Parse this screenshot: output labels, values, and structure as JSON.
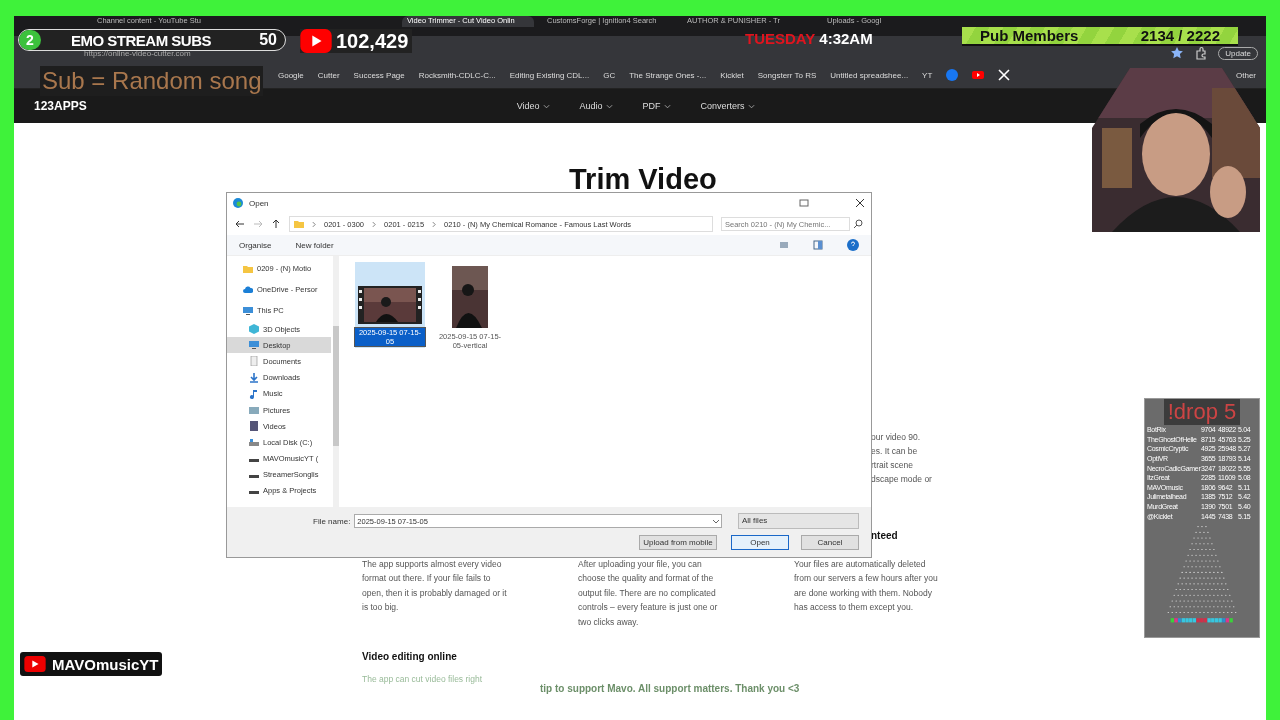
{
  "browser": {
    "tabs": [
      {
        "label": "Channel content - YouTube Stu",
        "selected": false
      },
      {
        "label": "Video Trimmer - Cut Video Onlin",
        "selected": true
      },
      {
        "label": "CustomsForge | Ignition4 Search",
        "selected": false
      },
      {
        "label": "AUTHOR & PUNISHER - Tr",
        "selected": false
      },
      {
        "label": "Uploads - Googl",
        "selected": false
      }
    ],
    "address": "https://online-video-cutter.com",
    "update_button": "Update",
    "bookmarks": [
      {
        "label": "Google"
      },
      {
        "label": "Cutter"
      },
      {
        "label": "Success Page"
      },
      {
        "label": "Rocksmith-CDLC-C..."
      },
      {
        "label": "Editing Existing CDL..."
      },
      {
        "label": "GC"
      },
      {
        "label": "The Strange Ones -..."
      },
      {
        "label": "Kicklet"
      },
      {
        "label": "Songsterr To RS"
      },
      {
        "label": "Untitled spreadshee..."
      },
      {
        "label": "YT"
      }
    ],
    "other_bookmarks": "Other"
  },
  "site": {
    "logo": "123APPS",
    "nav": [
      "Video",
      "Audio",
      "PDF",
      "Converters"
    ],
    "heading": "Trim Video",
    "partial_lines": [
      "our video 90.",
      "es. It can be",
      "rtrait scene",
      "dscape mode or"
    ],
    "partial_heading": "nteed",
    "features": [
      "The app supports almost every video format out there. If your file fails to open, then it is probably damaged or it is too big.",
      "After uploading your file, you can choose the quality and format of the output file. There are no complicated controls – every feature is just one or two clicks away.",
      "Your files are automatically deleted from our servers a few hours after you are done working with them. Nobody has access to them except you."
    ],
    "section_heading": "Video editing online",
    "section_text": "The app can cut video files right"
  },
  "dialog": {
    "title": "Open",
    "path": [
      "0201 - 0300",
      "0201 - 0215",
      "0210 - (N) My Chemical Romance - Famous Last Words"
    ],
    "search_placeholder": "Search 0210 - (N) My Chemic...",
    "toolbar": [
      "Organise",
      "New folder"
    ],
    "tree": [
      {
        "label": "0209 - (N) Motio",
        "kind": "folder",
        "selected": false
      },
      {
        "label": "OneDrive - Persor",
        "kind": "cloud",
        "selected": false
      },
      {
        "label": "This PC",
        "kind": "pc",
        "selected": false
      },
      {
        "label": "3D Objects",
        "kind": "cube",
        "selected": false
      },
      {
        "label": "Desktop",
        "kind": "desktop",
        "selected": true
      },
      {
        "label": "Documents",
        "kind": "doc",
        "selected": false
      },
      {
        "label": "Downloads",
        "kind": "download",
        "selected": false
      },
      {
        "label": "Music",
        "kind": "music",
        "selected": false
      },
      {
        "label": "Pictures",
        "kind": "pictures",
        "selected": false
      },
      {
        "label": "Videos",
        "kind": "videos",
        "selected": false
      },
      {
        "label": "Local Disk (C:)",
        "kind": "disk",
        "selected": false
      },
      {
        "label": "MAVOmusicYT (",
        "kind": "drive",
        "selected": false
      },
      {
        "label": "StreamerSonglis",
        "kind": "drive",
        "selected": false
      },
      {
        "label": "Apps & Projects",
        "kind": "drive",
        "selected": false
      }
    ],
    "files": [
      {
        "name": "2025-09-15 07-15-05",
        "kind": "landscape",
        "selected": true
      },
      {
        "name": "2025-09-15 07-15-05-vertical",
        "kind": "portrait",
        "selected": false
      }
    ],
    "file_name_label": "File name:",
    "file_name": "2025-09-15 07-15-05",
    "file_type": "All files",
    "buttons": [
      "Upload from mobile",
      "Open",
      "Cancel"
    ]
  },
  "overlay": {
    "sub_goal": {
      "count": "2",
      "label": "EMO STREAM SUBS",
      "target": "50"
    },
    "youtube_subs": "102,429",
    "sub_note": "Sub = Random song",
    "day": "TUESDAY",
    "time": "4:32AM",
    "members": {
      "label": "Pub Members",
      "value": "2134 / 2222"
    },
    "channel_badge": "MAVOmusicYT",
    "ticker": "tip to support Mavo. All support matters. Thank you <3",
    "drop": {
      "title": "!drop 5",
      "rows": [
        {
          "name": "BotRix",
          "col_2": "9704",
          "col_3": "48922",
          "col_4": "5.04"
        },
        {
          "name": "TheGhostOfHelle",
          "col_2": "8715",
          "col_3": "45763",
          "col_4": "5.25"
        },
        {
          "name": "CosmicCryptic",
          "col_2": "4925",
          "col_3": "25948",
          "col_4": "5.27"
        },
        {
          "name": "OptiVR",
          "col_2": "3655",
          "col_3": "18793",
          "col_4": "5.14"
        },
        {
          "name": "NecroCadicGamer",
          "col_2": "3247",
          "col_3": "18022",
          "col_4": "5.55"
        },
        {
          "name": "ItzGreat",
          "col_2": "2285",
          "col_3": "11609",
          "col_4": "5.08"
        },
        {
          "name": "MAVOmusic",
          "col_2": "1806",
          "col_3": "9642",
          "col_4": "5.11"
        },
        {
          "name": "Julimetalhead",
          "col_2": "1385",
          "col_3": "7512",
          "col_4": "5.42"
        },
        {
          "name": "MurdGreat",
          "col_2": "1390",
          "col_3": "7501",
          "col_4": "5.40"
        },
        {
          "name": "@Kicklet",
          "col_2": "1445",
          "col_3": "7438",
          "col_4": "5.15"
        }
      ]
    }
  }
}
